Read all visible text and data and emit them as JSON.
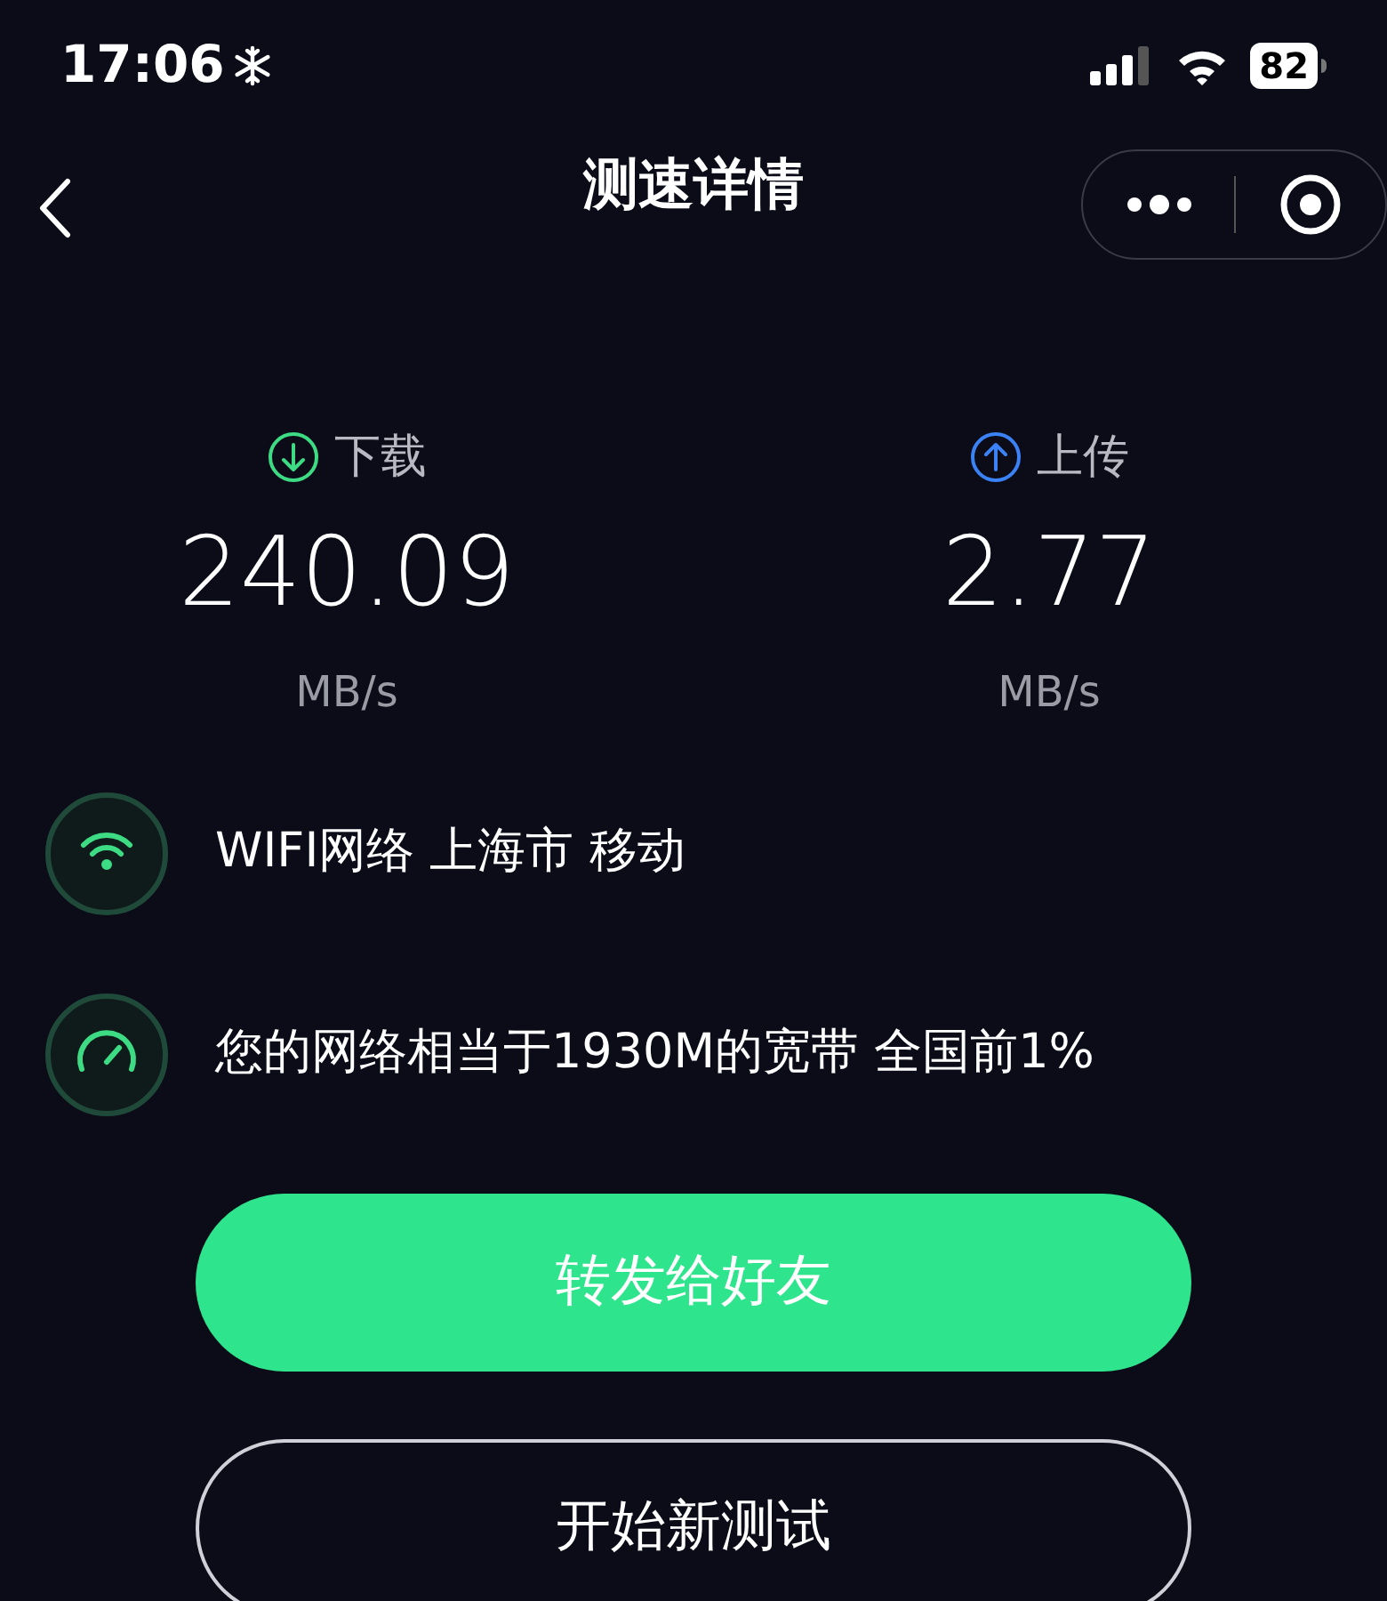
{
  "status_bar": {
    "time": "17:06",
    "battery": "82"
  },
  "nav": {
    "title": "测速详情"
  },
  "stats": [
    {
      "kind": "download",
      "label": "下载",
      "value": "240.09",
      "unit": "MB/s",
      "color": "#3ddc84"
    },
    {
      "kind": "upload",
      "label": "上传",
      "value": "2.77",
      "unit": "MB/s",
      "color": "#3b82f6"
    }
  ],
  "info": [
    {
      "kind": "wifi",
      "text": "WIFI网络 上海市 移动"
    },
    {
      "kind": "gauge",
      "text": "您的网络相当于1930M的宽带 全国前1%"
    }
  ],
  "buttons": [
    {
      "kind": "primary",
      "label": "转发给好友"
    },
    {
      "kind": "outline",
      "label": "开始新测试"
    }
  ]
}
